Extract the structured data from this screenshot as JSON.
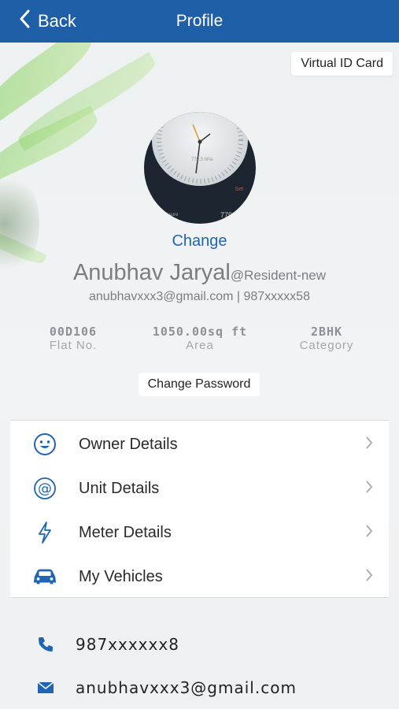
{
  "header": {
    "back_label": "Back",
    "title": "Profile"
  },
  "virtual_id_label": "Virtual ID Card",
  "profile": {
    "change_label": "Change",
    "name": "Anubhav Jaryal",
    "role": "@Resident-new",
    "contact_line": "anubhavxxx3@gmail.com | 987xxxxx58"
  },
  "stats": [
    {
      "value": "00D106",
      "label": "Flat No."
    },
    {
      "value": "1050.00sq ft",
      "label": "Area"
    },
    {
      "value": "2BHK",
      "label": "Category"
    }
  ],
  "change_password_label": "Change Password",
  "menu": [
    {
      "label": "Owner Details",
      "icon": "smiley-icon"
    },
    {
      "label": "Unit Details",
      "icon": "at-icon"
    },
    {
      "label": "Meter Details",
      "icon": "lightning-icon"
    },
    {
      "label": "My Vehicles",
      "icon": "car-icon"
    }
  ],
  "contact": {
    "phone": "987xxxxxx8",
    "email": "anubhavxxx3@gmail.com"
  },
  "colors": {
    "accent": "#1e5fa8",
    "link": "#1e66b4",
    "muted": "#7a7d82"
  },
  "avatar_text": {
    "dial_reading": "779.3 hPa",
    "red_label": "Set",
    "small_label": "pressure",
    "num": "779"
  }
}
